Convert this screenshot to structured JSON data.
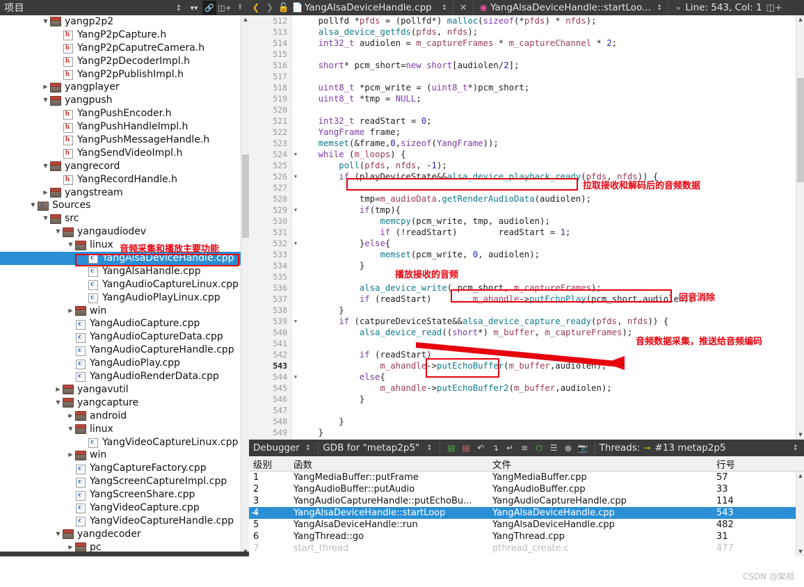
{
  "project_panel": {
    "title": "项目",
    "icons": [
      "sort-icon",
      "filter-icon",
      "link-icon",
      "split-icon",
      "collapse-icon"
    ],
    "tree": [
      {
        "depth": 2,
        "arrow": "down",
        "icon": "folder",
        "label": "yangp2p2"
      },
      {
        "depth": 3,
        "arrow": "none",
        "icon": "hfile",
        "label": "YangP2pCapture.h"
      },
      {
        "depth": 3,
        "arrow": "none",
        "icon": "hfile",
        "label": "YangP2pCaputreCamera.h"
      },
      {
        "depth": 3,
        "arrow": "none",
        "icon": "hfile",
        "label": "YangP2pDecoderImpl.h"
      },
      {
        "depth": 3,
        "arrow": "none",
        "icon": "hfile",
        "label": "YangP2pPublishImpl.h"
      },
      {
        "depth": 2,
        "arrow": "right",
        "icon": "folder",
        "label": "yangplayer"
      },
      {
        "depth": 2,
        "arrow": "down",
        "icon": "folder",
        "label": "yangpush"
      },
      {
        "depth": 3,
        "arrow": "none",
        "icon": "hfile",
        "label": "YangPushEncoder.h"
      },
      {
        "depth": 3,
        "arrow": "none",
        "icon": "hfile",
        "label": "YangPushHandleImpl.h"
      },
      {
        "depth": 3,
        "arrow": "none",
        "icon": "hfile",
        "label": "YangPushMessageHandle.h"
      },
      {
        "depth": 3,
        "arrow": "none",
        "icon": "hfile",
        "label": "YangSendVideoImpl.h"
      },
      {
        "depth": 2,
        "arrow": "down",
        "icon": "folder",
        "label": "yangrecord"
      },
      {
        "depth": 3,
        "arrow": "none",
        "icon": "hfile",
        "label": "YangRecordHandle.h"
      },
      {
        "depth": 2,
        "arrow": "right",
        "icon": "folder",
        "label": "yangstream"
      },
      {
        "depth": 1,
        "arrow": "down",
        "icon": "sources",
        "label": "Sources"
      },
      {
        "depth": 2,
        "arrow": "down",
        "icon": "folder",
        "label": "src"
      },
      {
        "depth": 3,
        "arrow": "down",
        "icon": "folder",
        "label": "yangaudiodev"
      },
      {
        "depth": 4,
        "arrow": "down",
        "icon": "folder",
        "label": "linux"
      },
      {
        "depth": 5,
        "arrow": "none",
        "icon": "cppfile",
        "label": "YangAlsaDeviceHandle.cpp",
        "selected": true
      },
      {
        "depth": 5,
        "arrow": "none",
        "icon": "cppfile",
        "label": "YangAlsaHandle.cpp"
      },
      {
        "depth": 5,
        "arrow": "none",
        "icon": "cppfile",
        "label": "YangAudioCaptureLinux.cpp"
      },
      {
        "depth": 5,
        "arrow": "none",
        "icon": "cppfile",
        "label": "YangAudioPlayLinux.cpp"
      },
      {
        "depth": 4,
        "arrow": "right",
        "icon": "folder",
        "label": "win"
      },
      {
        "depth": 4,
        "arrow": "none",
        "icon": "cppfile",
        "label": "YangAudioCapture.cpp"
      },
      {
        "depth": 4,
        "arrow": "none",
        "icon": "cppfile",
        "label": "YangAudioCaptureData.cpp"
      },
      {
        "depth": 4,
        "arrow": "none",
        "icon": "cppfile",
        "label": "YangAudioCaptureHandle.cpp"
      },
      {
        "depth": 4,
        "arrow": "none",
        "icon": "cppfile",
        "label": "YangAudioPlay.cpp"
      },
      {
        "depth": 4,
        "arrow": "none",
        "icon": "cppfile",
        "label": "YangAudioRenderData.cpp"
      },
      {
        "depth": 3,
        "arrow": "right",
        "icon": "folder",
        "label": "yangavutil"
      },
      {
        "depth": 3,
        "arrow": "down",
        "icon": "folder",
        "label": "yangcapture"
      },
      {
        "depth": 4,
        "arrow": "right",
        "icon": "folder",
        "label": "android"
      },
      {
        "depth": 4,
        "arrow": "down",
        "icon": "folder",
        "label": "linux"
      },
      {
        "depth": 5,
        "arrow": "none",
        "icon": "cppfile",
        "label": "YangVideoCaptureLinux.cpp"
      },
      {
        "depth": 4,
        "arrow": "right",
        "icon": "folder",
        "label": "win"
      },
      {
        "depth": 4,
        "arrow": "none",
        "icon": "cppfile",
        "label": "YangCaptureFactory.cpp"
      },
      {
        "depth": 4,
        "arrow": "none",
        "icon": "cppfile",
        "label": "YangScreenCaptureImpl.cpp"
      },
      {
        "depth": 4,
        "arrow": "none",
        "icon": "cppfile",
        "label": "YangScreenShare.cpp"
      },
      {
        "depth": 4,
        "arrow": "none",
        "icon": "cppfile",
        "label": "YangVideoCapture.cpp"
      },
      {
        "depth": 4,
        "arrow": "none",
        "icon": "cppfile",
        "label": "YangVideoCaptureHandle.cpp"
      },
      {
        "depth": 3,
        "arrow": "down",
        "icon": "folder",
        "label": "yangdecoder"
      },
      {
        "depth": 4,
        "arrow": "right",
        "icon": "folder",
        "label": "pc"
      }
    ],
    "annotation": "音频采集和播放主要功能"
  },
  "editor_toolbar": {
    "back_icon": "chevron-left-icon",
    "forward_icon": "chevron-right-icon",
    "lock_icon": "unlock-icon",
    "file_icon": "cpp-file-icon",
    "file_name": "YangAlsaDeviceHandle.cpp",
    "file_dropdown_icon": "updown-chevron-icon",
    "close_icon": "close-icon",
    "symbol_icon": "function-icon",
    "symbol_name": "YangAlsaDeviceHandle::startLoo...",
    "symbol_dropdown_icon": "updown-chevron-icon",
    "overflow_icon": "more-icon",
    "cursor_position": "Line: 543, Col: 1",
    "split_icon": "split-editor-icon"
  },
  "code": {
    "first_line": 512,
    "current_line": 543,
    "lines": [
      {
        "n": 512,
        "fold": "",
        "html": "    <span class='var'>pollfd</span> <span class='op'>*</span><span class='mem'>pfds</span> <span class='op'>=</span> (<span class='var'>pollfd</span><span class='op'>*</span>) <span class='fn'>malloc</span>(<span class='kw'>sizeof</span>(<span class='op'>*</span><span class='mem'>pfds</span>) <span class='op'>*</span> <span class='mem'>nfds</span>);"
      },
      {
        "n": 513,
        "fold": "",
        "html": "    <span class='fn'>alsa_device_getfds</span>(<span class='mem'>pfds</span>, <span class='mem'>nfds</span>);"
      },
      {
        "n": 514,
        "fold": "",
        "html": "    <span class='typ'>int32_t</span> <span class='var'>audiolen</span> <span class='op'>=</span> <span class='mem'>m_captureFrames</span> <span class='op'>*</span> <span class='mem'>m_captureChannel</span> <span class='op'>*</span> <span class='num'>2</span>;"
      },
      {
        "n": 515,
        "fold": "",
        "html": ""
      },
      {
        "n": 516,
        "fold": "",
        "html": "    <span class='typ'>short</span><span class='op'>*</span> <span class='var'>pcm_short</span><span class='op'>=</span><span class='kw'>new</span> <span class='typ'>short</span>[<span class='var'>audiolen</span>/<span class='num'>2</span>];"
      },
      {
        "n": 517,
        "fold": "",
        "html": ""
      },
      {
        "n": 518,
        "fold": "",
        "html": "    <span class='typ'>uint8_t</span> <span class='op'>*</span><span class='var'>pcm_write</span> <span class='op'>=</span> (<span class='typ'>uint8_t</span><span class='op'>*</span>)<span class='var'>pcm_short</span>;"
      },
      {
        "n": 519,
        "fold": "",
        "html": "    <span class='typ'>uint8_t</span> <span class='op'>*</span><span class='var'>tmp</span> <span class='op'>=</span> <span class='kw'>NULL</span>;"
      },
      {
        "n": 520,
        "fold": "",
        "html": ""
      },
      {
        "n": 521,
        "fold": "",
        "html": "    <span class='typ'>int32_t</span> <span class='var'>readStart</span> <span class='op'>=</span> <span class='num'>0</span>;"
      },
      {
        "n": 522,
        "fold": "",
        "html": "    <span class='typ'>YangFrame</span> <span class='var'>frame</span>;"
      },
      {
        "n": 523,
        "fold": "",
        "html": "    <span class='fn'>memset</span>(<span class='op'>&amp;</span><span class='var'>frame</span>,<span class='num'>0</span>,<span class='kw'>sizeof</span>(<span class='typ'>YangFrame</span>));"
      },
      {
        "n": 524,
        "fold": "▼",
        "html": "    <span class='kw'>while</span> (<span class='mem'>m_loops</span>) {"
      },
      {
        "n": 525,
        "fold": "",
        "html": "        <span class='fn'>poll</span>(<span class='mem'>pfds</span>, <span class='mem'>nfds</span>, <span class='op'>-</span><span class='num'>1</span>);"
      },
      {
        "n": 526,
        "fold": "▼",
        "html": "        <span class='kw'>if</span> (<span class='var'>playDeviceState</span><span class='op'>&amp;&amp;</span><span class='fn'>alsa_device_playback_ready</span>(<span class='mem'>pfds</span>, <span class='mem'>nfds</span>)) {"
      },
      {
        "n": 527,
        "fold": "",
        "html": ""
      },
      {
        "n": 528,
        "fold": "",
        "html": "            <span class='var'>tmp</span><span class='op'>=</span><span class='mem'>m_audioData</span>.<span class='fn'>getRenderAudioData</span>(<span class='var'>audiolen</span>);"
      },
      {
        "n": 529,
        "fold": "▼",
        "html": "            <span class='kw'>if</span>(<span class='var'>tmp</span>){"
      },
      {
        "n": 530,
        "fold": "",
        "html": "                <span class='fn'>memcpy</span>(<span class='var'>pcm_write</span>, <span class='var'>tmp</span>, <span class='var'>audiolen</span>);"
      },
      {
        "n": 531,
        "fold": "",
        "html": "                <span class='kw'>if</span> (!<span class='var'>readStart</span>)        <span class='var'>readStart</span> <span class='op'>=</span> <span class='num'>1</span>;"
      },
      {
        "n": 532,
        "fold": "▼",
        "html": "            }<span class='kw'>else</span>{"
      },
      {
        "n": 533,
        "fold": "",
        "html": "                <span class='fn'>memset</span>(<span class='var'>pcm_write</span>, <span class='num'>0</span>, <span class='var'>audiolen</span>);"
      },
      {
        "n": 534,
        "fold": "",
        "html": "            }"
      },
      {
        "n": 535,
        "fold": "",
        "html": ""
      },
      {
        "n": 536,
        "fold": "",
        "html": "            <span class='fn'>alsa_device_write</span>( <span class='var'>pcm_short</span>, <span class='mem'>m_captureFrames</span>);"
      },
      {
        "n": 537,
        "fold": "",
        "html": "            <span class='kw'>if</span> (<span class='var'>readStart</span>)        <span class='mem'>m_ahandle</span><span class='op'>-&gt;</span><span class='fn'>putEchoPlay</span>(<span class='var'>pcm_short</span>,<span class='var'>audiolen</span>);"
      },
      {
        "n": 538,
        "fold": "",
        "html": "        }"
      },
      {
        "n": 539,
        "fold": "▼",
        "html": "        <span class='kw'>if</span> (<span class='var'>catpureDeviceState</span><span class='op'>&amp;&amp;</span><span class='fn'>alsa_device_capture_ready</span>(<span class='mem'>pfds</span>, <span class='mem'>nfds</span>)) {"
      },
      {
        "n": 540,
        "fold": "",
        "html": "            <span class='fn'>alsa_device_read</span>((<span class='typ'>short</span><span class='op'>*</span>) <span class='mem'>m_buffer</span>, <span class='mem'>m_captureFrames</span>);"
      },
      {
        "n": 541,
        "fold": "",
        "html": ""
      },
      {
        "n": 542,
        "fold": "",
        "html": "            <span class='kw'>if</span> (<span class='var'>readStart</span>)"
      },
      {
        "n": 543,
        "fold": "",
        "html": "                <span class='mem'>m_ahandle</span><span class='op'>-&gt;</span><span class='fn'>putEchoBuffer</span>(<span class='mem'>m_buffer</span>,<span class='var'>audiolen</span>);"
      },
      {
        "n": 544,
        "fold": "▼",
        "html": "            <span class='kw'>else</span>{"
      },
      {
        "n": 545,
        "fold": "",
        "html": "                <span class='mem'>m_ahandle</span><span class='op'>-&gt;</span><span class='fn'>putEchoBuffer2</span>(<span class='mem'>m_buffer</span>,<span class='var'>audiolen</span>);"
      },
      {
        "n": 546,
        "fold": "",
        "html": "            }"
      },
      {
        "n": 547,
        "fold": "",
        "html": ""
      },
      {
        "n": 548,
        "fold": "",
        "html": "        }"
      },
      {
        "n": 549,
        "fold": "",
        "html": "    }"
      }
    ],
    "annotations": [
      {
        "name": "annot-pull-decoded-audio",
        "text": "拉取接收和解码后的音频数据"
      },
      {
        "name": "annot-play-received-audio",
        "text": "播放接收的音频"
      },
      {
        "name": "annot-echo-cancel",
        "text": "回音消除"
      },
      {
        "name": "annot-audio-capture-push",
        "text": "音频数据采集，推送给音频编码"
      }
    ]
  },
  "debugger": {
    "label": "Debugger",
    "dropdown_icon": "updown-chevron-icon",
    "target": "GDB for \"metap2p5\"",
    "target_dropdown_icon": "updown-chevron-icon",
    "toolbar_icons": [
      "step-in-green-icon",
      "step-out-red-icon",
      "step-over-icon",
      "step-into-icon",
      "step-return-icon",
      "continue-icon",
      "interrupt-icon",
      "restart-icon",
      "record-icon",
      "screenshot-icon"
    ],
    "threads_label": "Threads:",
    "thread_arrow_icon": "arrow-right-icon",
    "thread_value": "#13 metap2p5",
    "threads_dropdown_icon": "updown-chevron-icon",
    "columns": [
      "级别",
      "函数",
      "文件",
      "行号"
    ],
    "rows": [
      {
        "level": "1",
        "func": "YangMediaBuffer::putFrame",
        "file": "YangMediaBuffer.cpp",
        "line": "57"
      },
      {
        "level": "2",
        "func": "YangAudioBuffer::putAudio",
        "file": "YangAudioBuffer.cpp",
        "line": "33"
      },
      {
        "level": "3",
        "func": "YangAudioCaptureHandle::putEchoBu...",
        "file": "YangAudioCaptureHandle.cpp",
        "line": "114"
      },
      {
        "level": "4",
        "func": "YangAlsaDeviceHandle::startLoop",
        "file": "YangAlsaDeviceHandle.cpp",
        "line": "543",
        "selected": true
      },
      {
        "level": "5",
        "func": "YangAlsaDeviceHandle::run",
        "file": "YangAlsaDeviceHandle.cpp",
        "line": "482"
      },
      {
        "level": "6",
        "func": "YangThread::go",
        "file": "YangThread.cpp",
        "line": "31"
      },
      {
        "level": "7",
        "func": "start_thread",
        "file": "pthread_create.c",
        "line": "477",
        "faded": true
      }
    ]
  },
  "watermark": "CSDN @架相",
  "colors": {
    "accent_blue": "#2a8fd4",
    "annotation_red": "#e8000d",
    "toolbar_dark": "#3b3b3b"
  }
}
